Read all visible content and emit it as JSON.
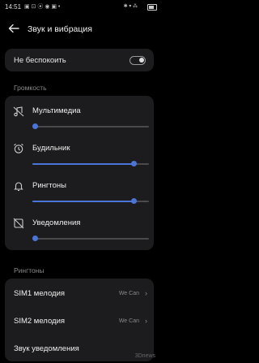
{
  "status": {
    "time": "14:51",
    "icons": "▣ ⊡ ⦿ ◉ ▣ •",
    "network": "✱ ▾ ⁂"
  },
  "header": {
    "title": "Звук и вибрация"
  },
  "dnd": {
    "label": "Не беспокоить",
    "enabled": false
  },
  "volume": {
    "section_label": "Громкость",
    "items": [
      {
        "label": "Мультимедиа",
        "icon": "music-muted-icon",
        "level": 0.0
      },
      {
        "label": "Будильник",
        "icon": "alarm-icon",
        "level": 0.87
      },
      {
        "label": "Рингтоны",
        "icon": "bell-icon",
        "level": 0.87
      },
      {
        "label": "Уведомления",
        "icon": "notification-muted-icon",
        "level": 0.0
      }
    ]
  },
  "ringtones": {
    "section_label": "Рингтоны",
    "items": [
      {
        "label": "SIM1 мелодия",
        "value": "We Can"
      },
      {
        "label": "SIM2 мелодия",
        "value": "We Can"
      },
      {
        "label": "Звук уведомления",
        "value": ""
      }
    ]
  },
  "watermark": "3Dnews",
  "colors": {
    "accent": "#4a74d6",
    "card": "#1c1c1e",
    "background": "#000000"
  }
}
